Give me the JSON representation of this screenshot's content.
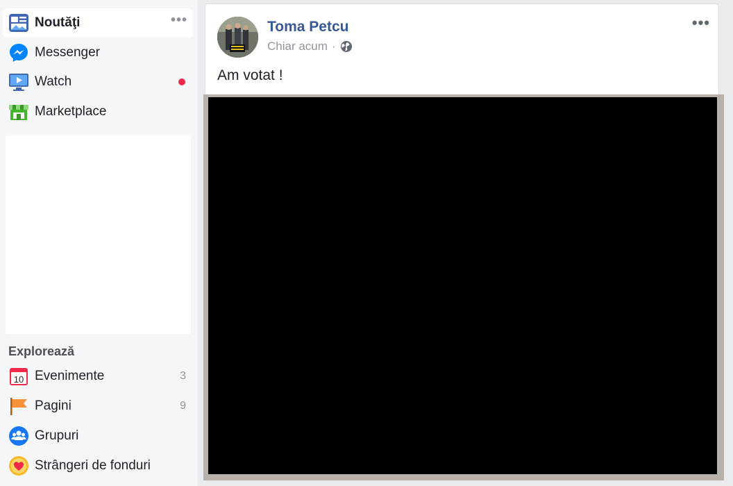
{
  "sidebar": {
    "items": [
      {
        "label": "Noutăţi",
        "icon": "news-feed-icon",
        "active": true
      },
      {
        "label": "Messenger",
        "icon": "messenger-icon"
      },
      {
        "label": "Watch",
        "icon": "watch-icon",
        "notification": true
      },
      {
        "label": "Marketplace",
        "icon": "marketplace-icon"
      }
    ],
    "more_label": "•••",
    "explore_heading": "Explorează",
    "explore_items": [
      {
        "label": "Evenimente",
        "count": "3",
        "icon": "calendar-icon"
      },
      {
        "label": "Pagini",
        "count": "9",
        "icon": "flag-icon"
      },
      {
        "label": "Grupuri",
        "icon": "groups-icon"
      },
      {
        "label": "Strângeri de fonduri",
        "icon": "fundraiser-icon"
      }
    ],
    "calendar_day": "10"
  },
  "post": {
    "author": "Toma Petcu",
    "time": "Chiar acum",
    "separator": "·",
    "privacy_icon": "globe-icon",
    "more_label": "•••",
    "text": "Am votat !"
  },
  "colors": {
    "author_link": "#365899",
    "notification_dot": "#f02849",
    "page_bg": "#e9ebee"
  }
}
